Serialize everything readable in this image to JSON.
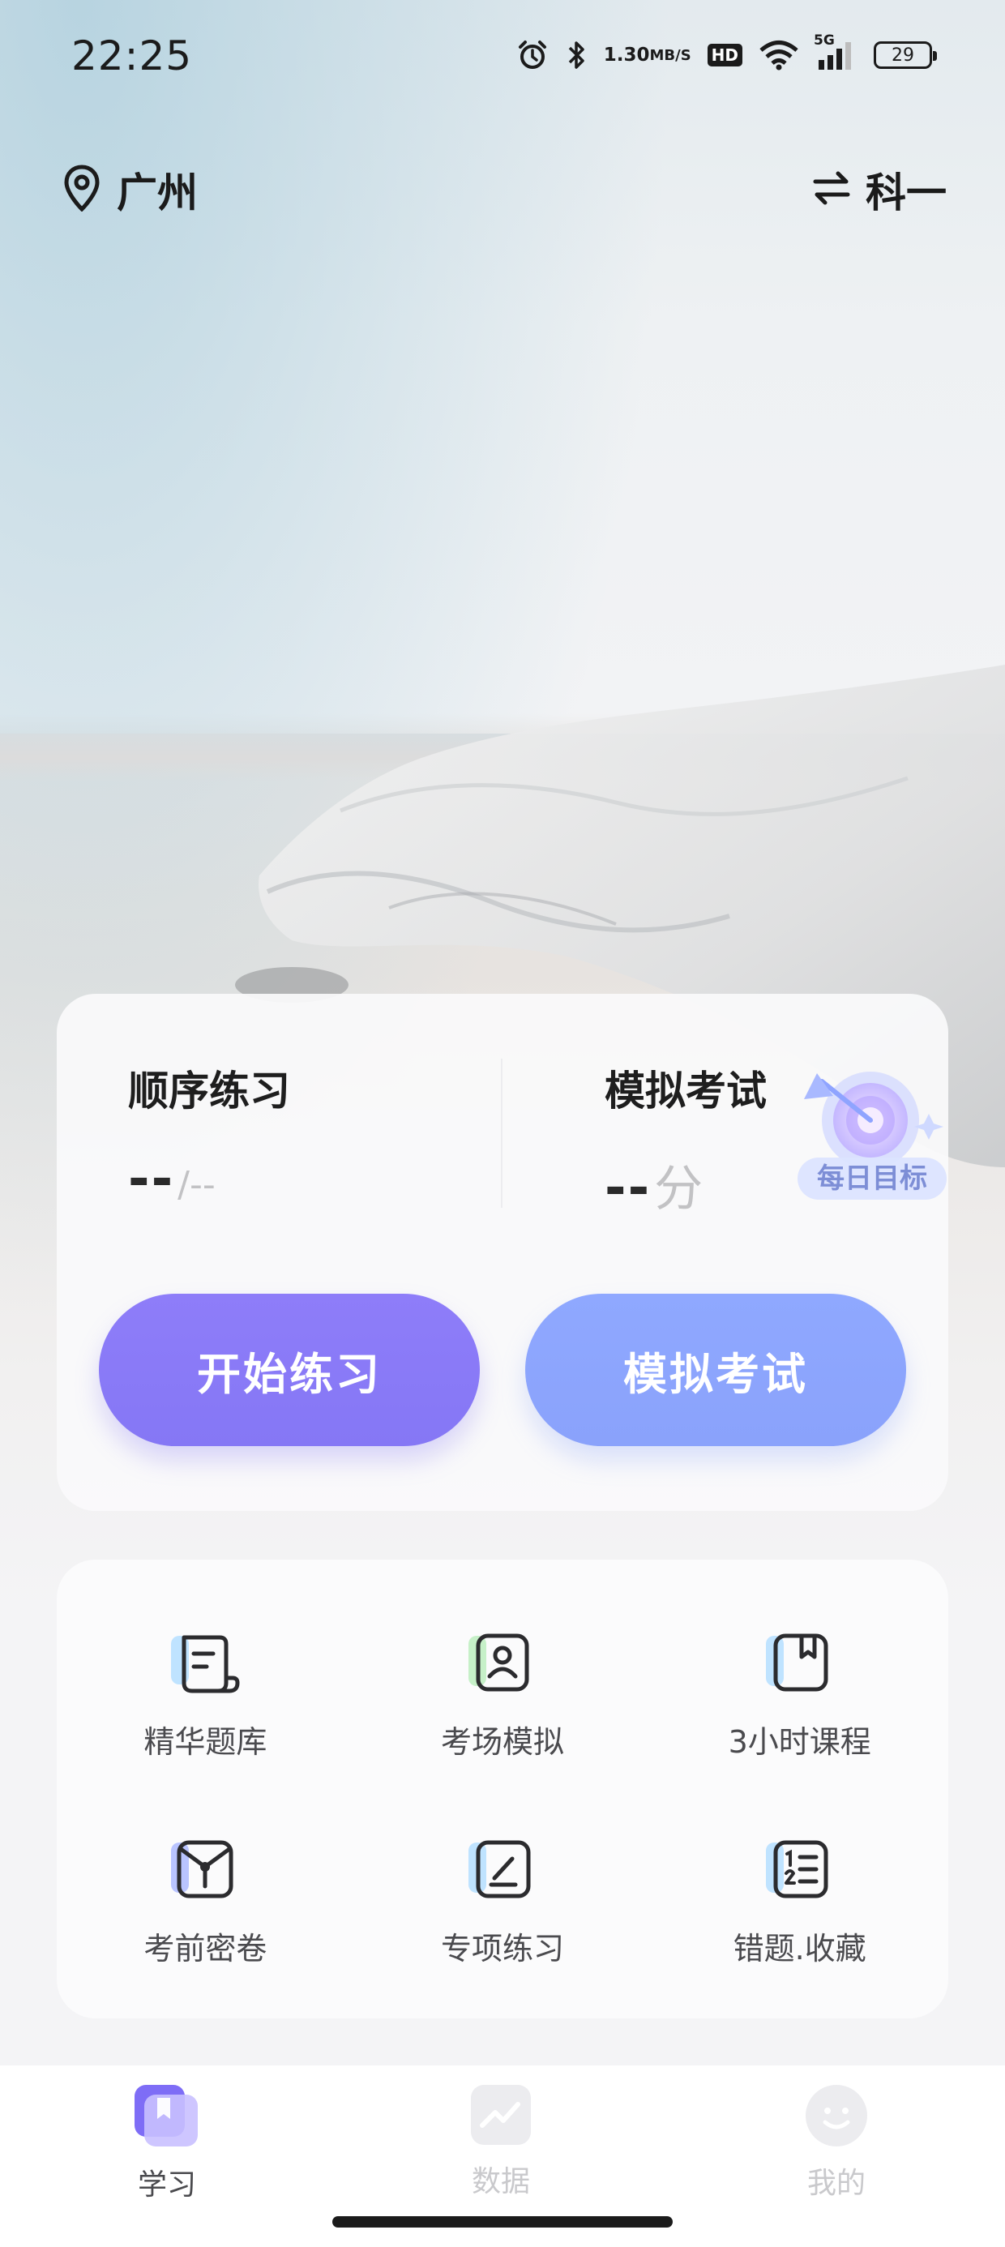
{
  "status_bar": {
    "time": "22:25",
    "net_speed_value": "1.30",
    "net_speed_unit": "MB/S",
    "hd": "HD",
    "signal": "5G",
    "battery": "29"
  },
  "header": {
    "location": "广州",
    "location_icon": "map-pin-icon",
    "subject": "科一",
    "switch_icon": "swap-arrows-icon"
  },
  "stats": {
    "sequential": {
      "title": "顺序练习",
      "value": "--",
      "total": "/--"
    },
    "mock": {
      "title": "模拟考试",
      "value": "--",
      "unit": "分"
    }
  },
  "daily_goal": {
    "label": "每日目标",
    "icon": "target-icon"
  },
  "buttons": {
    "start_practice": "开始练习",
    "mock_exam": "模拟考试"
  },
  "features": [
    {
      "label": "精华题库",
      "icon": "scroll-icon"
    },
    {
      "label": "考场模拟",
      "icon": "id-badge-icon"
    },
    {
      "label": "3小时课程",
      "icon": "book-icon"
    },
    {
      "label": "考前密卷",
      "icon": "sealed-paper-icon"
    },
    {
      "label": "专项练习",
      "icon": "edit-icon"
    },
    {
      "label": "错题.收藏",
      "icon": "numbered-list-icon"
    }
  ],
  "tabs": [
    {
      "label": "学习",
      "icon": "bookmark-book-icon",
      "active": true
    },
    {
      "label": "数据",
      "icon": "chart-icon",
      "active": false
    },
    {
      "label": "我的",
      "icon": "smile-icon",
      "active": false
    }
  ],
  "colors": {
    "primary_purple": "#8577f5",
    "secondary_blue": "#8aa2fb",
    "tab_active": "#4a4a4e",
    "tab_inactive": "#c9c9cc"
  }
}
